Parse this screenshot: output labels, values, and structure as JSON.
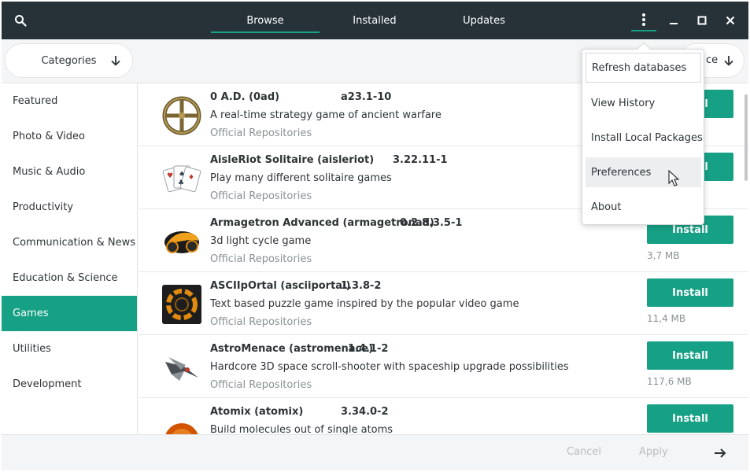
{
  "header": {
    "tabs": [
      {
        "label": "Browse",
        "active": true
      },
      {
        "label": "Installed",
        "active": false
      },
      {
        "label": "Updates",
        "active": false
      }
    ],
    "icons": [
      "search-icon",
      "menu-dots-icon",
      "minimize-icon",
      "maximize-icon",
      "close-icon"
    ]
  },
  "toolbar": {
    "categories_label": "Categories",
    "sort_label_partial": "ce"
  },
  "sidebar": {
    "items": [
      {
        "label": "Featured",
        "active": false
      },
      {
        "label": "Photo & Video",
        "active": false
      },
      {
        "label": "Music & Audio",
        "active": false
      },
      {
        "label": "Productivity",
        "active": false
      },
      {
        "label": "Communication & News",
        "active": false
      },
      {
        "label": "Education & Science",
        "active": false
      },
      {
        "label": "Games",
        "active": true
      },
      {
        "label": "Utilities",
        "active": false
      },
      {
        "label": "Development",
        "active": false
      }
    ]
  },
  "packages": [
    {
      "name": "0 A.D. (0ad)",
      "version": "a23.1-10",
      "description": "A real-time strategy game of ancient warfare",
      "repository": "Official Repositories",
      "size": "",
      "icon": "0ad-icon"
    },
    {
      "name": "AisleRiot Solitaire (aisleriot)",
      "version": "3.22.11-1",
      "description": "Play many different solitaire games",
      "repository": "Official Repositories",
      "size": "",
      "icon": "cards-icon"
    },
    {
      "name": "Armagetron Advanced (armagetronad)",
      "version": "0.2.8.3.5-1",
      "description": "3d light cycle game",
      "repository": "Official Repositories",
      "size": "3,7 MB",
      "icon": "lightcycle-icon"
    },
    {
      "name": "ASCIIpOrtal (asciiportal)",
      "version": "1.3.8-2",
      "description": "Text based puzzle game inspired by the popular video game",
      "repository": "Official Repositories",
      "size": "11,4 MB",
      "icon": "portal-icon"
    },
    {
      "name": "AstroMenace (astromenace)",
      "version": "1.4.1-2",
      "description": "Hardcore 3D space scroll-shooter with spaceship upgrade possibilities",
      "repository": "Official Repositories",
      "size": "117,6 MB",
      "icon": "spaceship-icon"
    },
    {
      "name": "Atomix (atomix)",
      "version": "3.34.0-2",
      "description": "Build molecules out of single atoms",
      "repository": "",
      "size": "",
      "icon": "atomix-icon"
    }
  ],
  "install_label": "Install",
  "footer": {
    "cancel_label": "Cancel",
    "apply_label": "Apply"
  },
  "menu": {
    "items": [
      {
        "label": "Refresh databases"
      },
      {
        "label": "View History"
      },
      {
        "label": "Install Local Packages"
      },
      {
        "label": "Preferences"
      },
      {
        "label": "About"
      }
    ]
  },
  "colors": {
    "header_bg": "#263238",
    "accent": "#16a085",
    "muted_text": "#8a9294"
  }
}
